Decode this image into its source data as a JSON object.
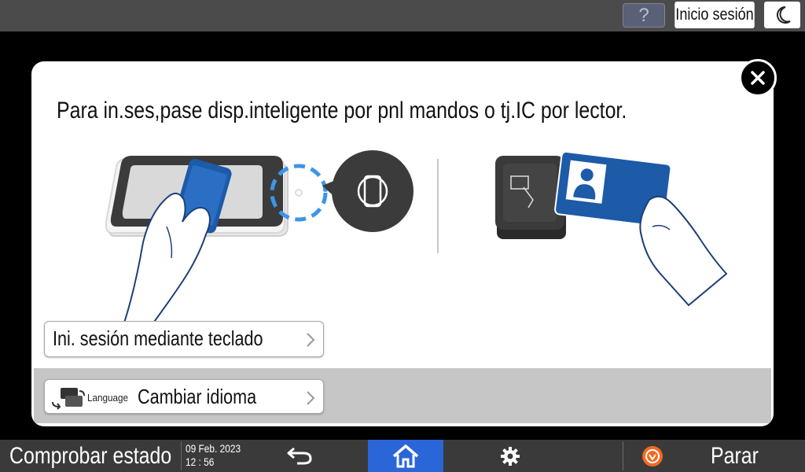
{
  "topbar": {
    "help_label": "?",
    "login_label": "Inicio sesión",
    "sleep_icon": "moon-icon"
  },
  "dialog": {
    "message": "Para in.ses,pase disp.inteligente por pnl mandos o tj.IC por lector.",
    "keyboard_login_label": "Ini. sesión mediante teclado",
    "language_small_label": "Language",
    "language_label": "Cambiar idioma",
    "close_icon": "close-icon"
  },
  "bottombar": {
    "status_label": "Comprobar estado",
    "date": "09 Feb. 2023",
    "time": "12 : 56",
    "stop_label": "Parar"
  },
  "colors": {
    "home_active": "#2b66d8",
    "nfc_ring": "#3d95e8",
    "card_blue": "#1d5aa8",
    "stop_orange": "#f26a21"
  }
}
